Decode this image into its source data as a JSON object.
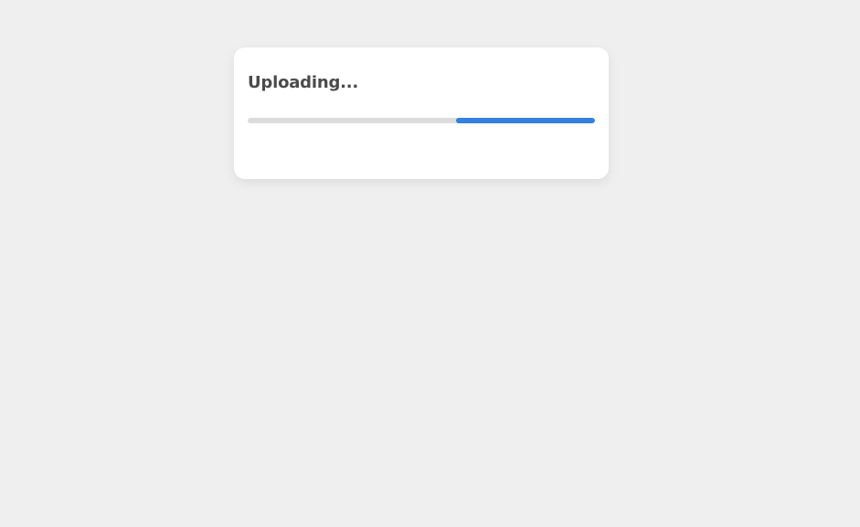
{
  "upload_dialog": {
    "title": "Uploading...",
    "progress": {
      "start_fraction": 0.6,
      "end_fraction": 1.0,
      "track_color": "#dcdcdc",
      "fill_color": "#3281e0"
    }
  },
  "colors": {
    "background": "#efefef",
    "card": "#ffffff",
    "text": "#4a4a4a"
  }
}
